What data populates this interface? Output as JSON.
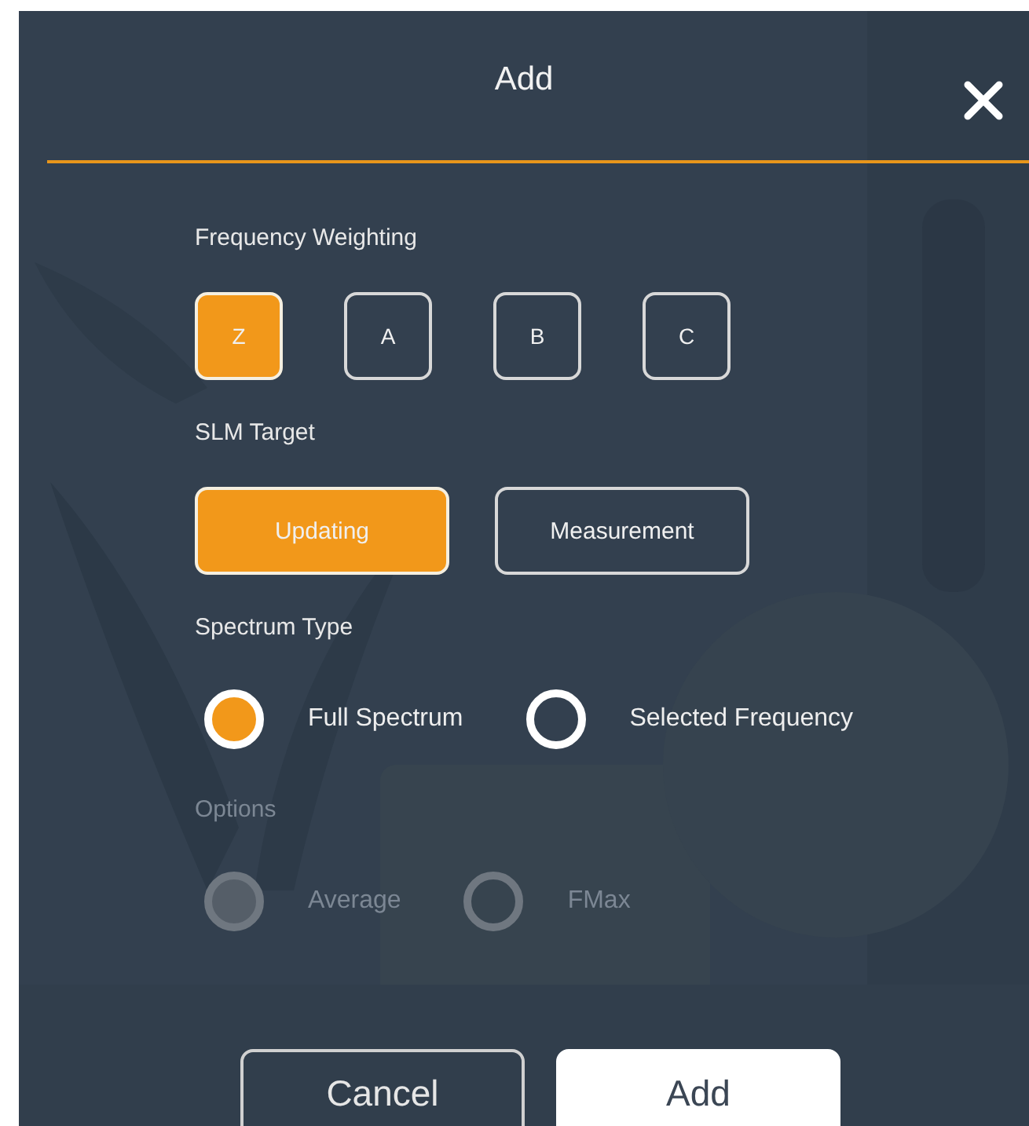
{
  "dialog": {
    "title": "Add"
  },
  "sections": [
    {
      "label": "Frequency Weighting",
      "kind": "square_buttons",
      "disabled": false,
      "options": [
        {
          "label": "Z",
          "selected": true
        },
        {
          "label": "A",
          "selected": false
        },
        {
          "label": "B",
          "selected": false
        },
        {
          "label": "C",
          "selected": false
        }
      ]
    },
    {
      "label": "SLM Target",
      "kind": "wide_buttons",
      "disabled": false,
      "options": [
        {
          "label": "Updating",
          "selected": true
        },
        {
          "label": "Measurement",
          "selected": false
        }
      ]
    },
    {
      "label": "Spectrum Type",
      "kind": "radios",
      "disabled": false,
      "options": [
        {
          "label": "Full Spectrum",
          "selected": true
        },
        {
          "label": "Selected Frequency",
          "selected": false
        }
      ]
    },
    {
      "label": "Options",
      "kind": "radios",
      "disabled": true,
      "options": [
        {
          "label": "Average",
          "selected": true
        },
        {
          "label": "FMax",
          "selected": false
        }
      ]
    }
  ],
  "buttons": [
    {
      "label": "Cancel",
      "kind": "outline"
    },
    {
      "label": "Add",
      "kind": "filled"
    }
  ]
}
